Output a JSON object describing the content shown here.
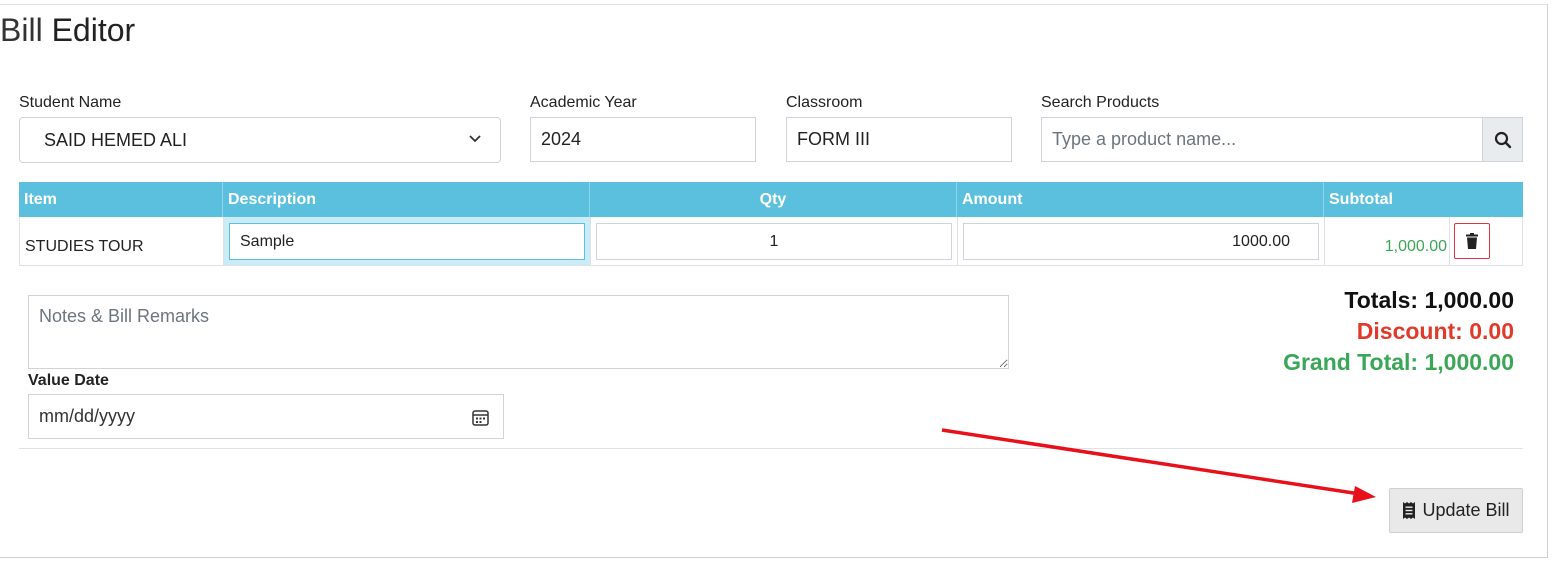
{
  "title": {
    "prefix": "Bill",
    "main": "Editor"
  },
  "fields": {
    "student_name": {
      "label": "Student Name",
      "value": "SAID HEMED ALI"
    },
    "academic_year": {
      "label": "Academic Year",
      "value": "2024"
    },
    "classroom": {
      "label": "Classroom",
      "value": "FORM III"
    },
    "search_products": {
      "label": "Search Products",
      "placeholder": "Type a product name..."
    }
  },
  "table": {
    "headers": [
      "Item",
      "Description",
      "Qty",
      "Amount",
      "Subtotal"
    ],
    "rows": [
      {
        "item": "STUDIES TOUR",
        "description": "Sample",
        "qty": "1",
        "amount": "1000.00",
        "subtotal": "1,000.00"
      }
    ]
  },
  "notes": {
    "placeholder": "Notes & Bill Remarks"
  },
  "value_date": {
    "label": "Value Date",
    "placeholder": "mm/dd/yyyy"
  },
  "totals": {
    "totals": "Totals: 1,000.00",
    "discount": "Discount: 0.00",
    "grand_total": "Grand Total: 1,000.00"
  },
  "update_button": {
    "label": "Update Bill"
  },
  "colors": {
    "header_bg": "#5bc0de",
    "discount": "#e03a2b",
    "grand_total": "#3aa657",
    "subtotal": "#3aa657",
    "arrow": "#e8101a"
  },
  "icons": [
    "chevron-down-icon",
    "search-icon",
    "trash-icon",
    "calendar-icon",
    "receipt-icon",
    "annotation-arrow"
  ]
}
